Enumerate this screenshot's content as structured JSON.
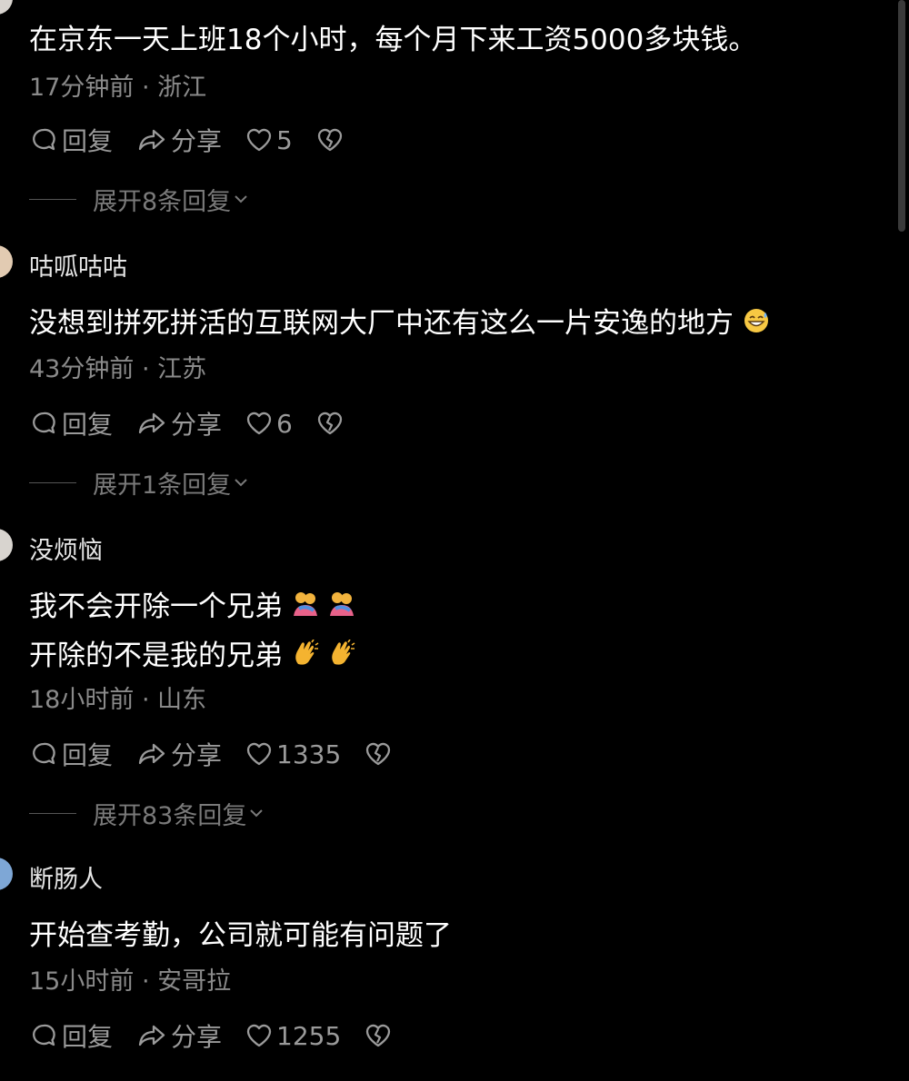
{
  "comments": [
    {
      "username": "",
      "lines": [
        "在京东一天上班18个小时，每个月下来工资5000多块钱。"
      ],
      "meta": "17分钟前 · 浙江",
      "reply_label": "回复",
      "share_label": "分享",
      "likes": "5",
      "expand_label": "展开8条回复"
    },
    {
      "username": "咕呱咕咕",
      "lines": [
        "没想到拼死拼活的互联网大厂中还有这么一片安逸的地方"
      ],
      "meta": "43分钟前 · 江苏",
      "reply_label": "回复",
      "share_label": "分享",
      "likes": "6",
      "expand_label": "展开1条回复"
    },
    {
      "username": "没烦恼",
      "lines": [
        "我不会开除一个兄弟",
        "开除的不是我的兄弟"
      ],
      "meta": "18小时前 · 山东",
      "reply_label": "回复",
      "share_label": "分享",
      "likes": "1335",
      "expand_label": "展开83条回复"
    },
    {
      "username": "断肠人",
      "lines": [
        "开始查考勤，公司就可能有问题了"
      ],
      "meta": "15小时前 · 安哥拉",
      "reply_label": "回复",
      "share_label": "分享",
      "likes": "1255"
    }
  ],
  "icons": {
    "reply": "comment-bubble-icon",
    "share": "share-arrow-icon",
    "like": "heart-icon",
    "dislike": "broken-heart-icon",
    "expand": "chevron-down-icon",
    "emoji_grin_sweat": "grinning-sweat-emoji",
    "emoji_hug": "people-hugging-emoji",
    "emoji_clap": "clapping-hands-emoji"
  },
  "colors": {
    "background": "#000000",
    "text": "#ffffff",
    "meta": "#8a8a8a",
    "action": "#9a9a9a"
  }
}
